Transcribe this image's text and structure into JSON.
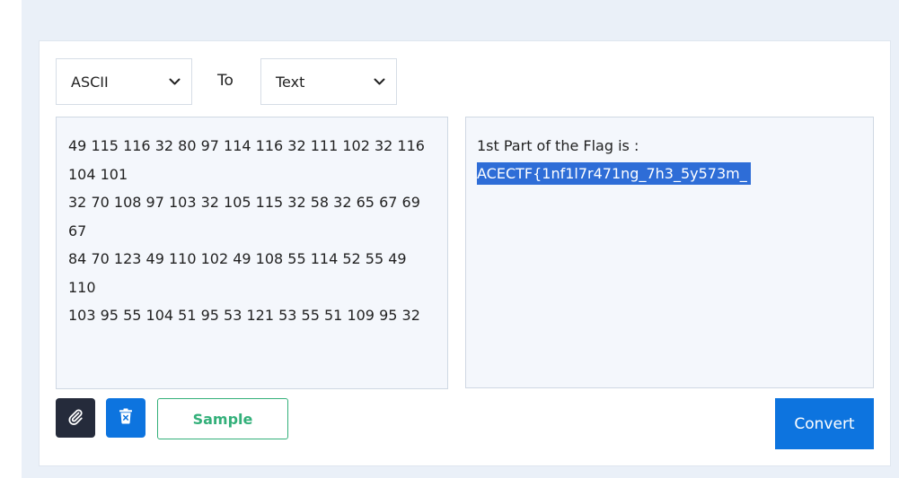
{
  "converter": {
    "from_select": {
      "value": "ASCII",
      "icon": "chevron-down-icon"
    },
    "to_label": "To",
    "to_select": {
      "value": "Text",
      "icon": "chevron-down-icon"
    },
    "input_lines": [
      "49 115 116 32 80 97 114 116 32 111 102 32 116 104 101",
      "32 70 108 97 103 32 105 115 32 58 32 65 67 69 67",
      "84 70 123 49 110 102 49 108 55 114 52 55 49 110",
      "103 95 55 104 51 95 53 121 53 55 51 109 95 32"
    ],
    "output_line1": "1st Part of the Flag is :",
    "output_line2": "ACECTF{1nf1l7r471ng_7h3_5y573m_",
    "actions": {
      "attach_icon": "paperclip-icon",
      "delete_icon": "trash-icon",
      "sample_label": "Sample",
      "convert_label": "Convert"
    },
    "colors": {
      "primary": "#0d74df",
      "dark": "#252b3b",
      "sample_green": "#33b07a",
      "selection": "#2e6dd7"
    }
  }
}
